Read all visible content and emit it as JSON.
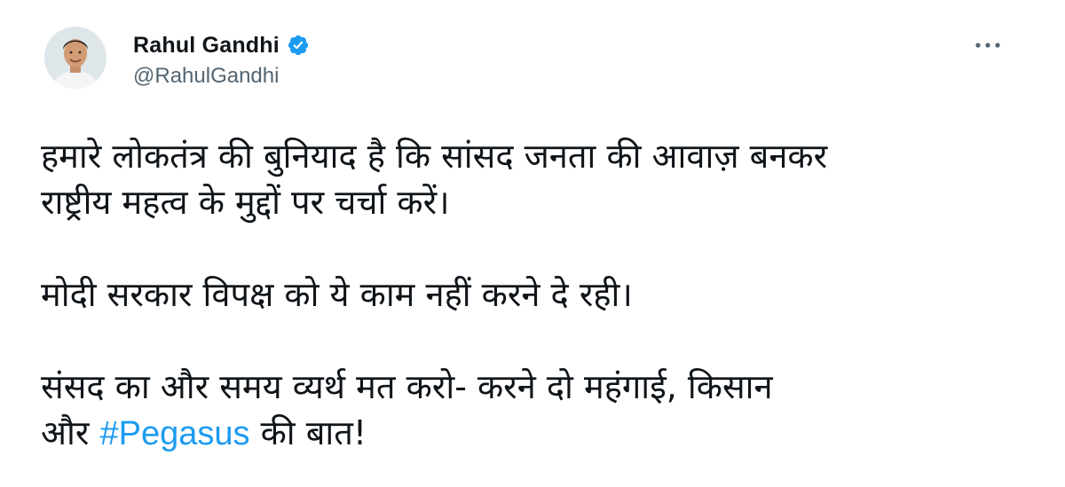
{
  "tweet": {
    "author": {
      "name": "Rahul Gandhi",
      "handle": "@RahulGandhi",
      "verified": true,
      "avatar_icon": "profile-photo"
    },
    "more_icon": "more-horizontal-icon",
    "body": {
      "paragraph1_line1": "हमारे लोकतंत्र की बुनियाद है कि सांसद जनता की आवाज़ बनकर",
      "paragraph1_line2": "राष्ट्रीय महत्व के मुद्दों पर चर्चा करें।",
      "paragraph2": "मोदी सरकार विपक्ष को ये काम नहीं करने दे रही।",
      "paragraph3_line1": "संसद का और समय व्यर्थ मत करो- करने दो महंगाई, किसान",
      "paragraph3_line2_prefix": "और ",
      "hashtag": "#Pegasus",
      "paragraph3_line2_suffix": " की बात!"
    }
  },
  "colors": {
    "text": "#0f1419",
    "handle": "#536471",
    "link": "#1d9bf0",
    "verified": "#1d9bf0"
  }
}
